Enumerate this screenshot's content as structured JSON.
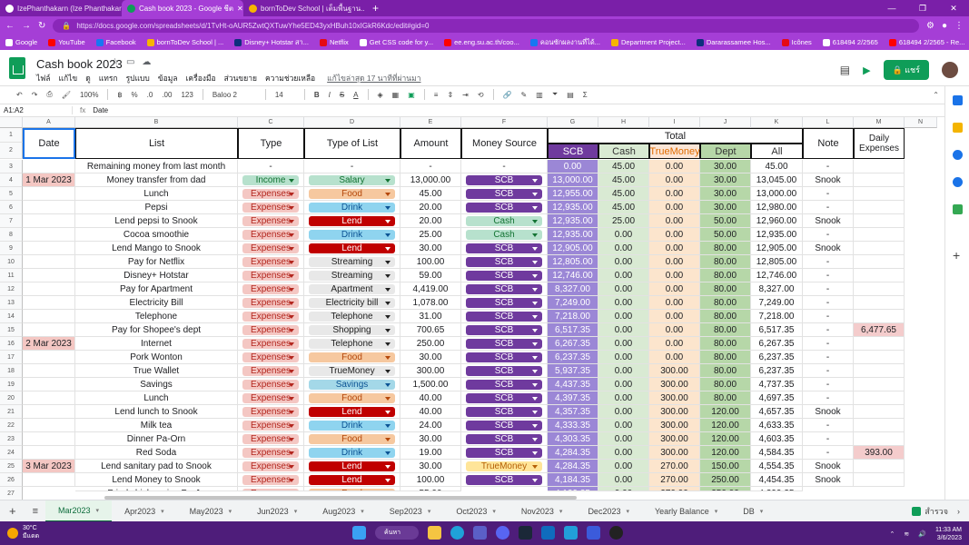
{
  "browser": {
    "tabs": [
      {
        "label": "IzePhanthakarn (Ize Phanthakar...",
        "active": false
      },
      {
        "label": "Cash book 2023 - Google ชีต",
        "active": true
      },
      {
        "label": "bornToDev School | เต็มพื้นฐาน...",
        "active": false
      }
    ],
    "url": "https://docs.google.com/spreadsheets/d/1TvHt-oAUR5ZwtQXTuwYhe5ED43yxHBuh10xIGkR6Kdc/edit#gid=0",
    "bookmarks": [
      "Google",
      "YouTube",
      "Facebook",
      "bornToDev School | ...",
      "Disney+ Hotstar สา...",
      "Netflix",
      "Get CSS code for y...",
      "ee.eng.su.ac.th/coo...",
      "คอนซักผลงานที่ได้...",
      "Department Project...",
      "Dararassamee Hos...",
      "Icônes",
      "618494 2/2565",
      "618494 2/2565 - Re..."
    ]
  },
  "app": {
    "title": "Cash book 2023",
    "menus": [
      "ไฟล์",
      "แก้ไข",
      "ดู",
      "แทรก",
      "รูปแบบ",
      "ข้อมูล",
      "เครื่องมือ",
      "ส่วนขยาย",
      "ความช่วยเหลือ"
    ],
    "last_edit": "แก้ไขล่าสุด 17 นาทีที่ผ่านมา",
    "share_label": "แชร์"
  },
  "toolbar": {
    "zoom": "100%",
    "currency": "฿",
    "percent": "%",
    "dec_less": ".0",
    "dec_more": ".00",
    "format_123": "123",
    "font": "Baloo 2",
    "size": "14",
    "bold": "B",
    "italic": "I",
    "strike": "S",
    "textcolor": "A"
  },
  "formula_bar": {
    "name_box": "A1:A2",
    "fx": "fx",
    "content": "Date"
  },
  "columns": [
    "A",
    "B",
    "C",
    "D",
    "E",
    "F",
    "G",
    "H",
    "I",
    "J",
    "K",
    "L",
    "M",
    "N"
  ],
  "headers": {
    "date": "Date",
    "list": "List",
    "type": "Type",
    "type_of_list": "Type of List",
    "amount": "Amount",
    "money_source": "Money Source",
    "total": "Total",
    "scb": "SCB",
    "cash": "Cash",
    "truemoney": "TrueMoney",
    "dept": "Dept",
    "all": "All",
    "note": "Note",
    "daily_expenses": "Daily Expenses"
  },
  "rows": [
    {
      "n": "3",
      "date": "",
      "list": "Remaining money from last month",
      "type": "-",
      "tol": "-",
      "amount": "-",
      "src": "-",
      "scb": "0.00",
      "cash": "45.00",
      "tm": "0.00",
      "dept": "30.00",
      "all": "45.00",
      "note": "-",
      "daily": ""
    },
    {
      "n": "4",
      "date": "1 Mar 2023",
      "list": "Money transfer from dad",
      "type": "Income",
      "tol": "Salary",
      "amount": "13,000.00",
      "src": "SCB",
      "scb": "13,000.00",
      "cash": "45.00",
      "tm": "0.00",
      "dept": "30.00",
      "all": "13,045.00",
      "note": "Snook",
      "daily": ""
    },
    {
      "n": "5",
      "date": "",
      "list": "Lunch",
      "type": "Expenses",
      "tol": "Food",
      "amount": "45.00",
      "src": "SCB",
      "scb": "12,955.00",
      "cash": "45.00",
      "tm": "0.00",
      "dept": "30.00",
      "all": "13,000.00",
      "note": "-",
      "daily": ""
    },
    {
      "n": "6",
      "date": "",
      "list": "Pepsi",
      "type": "Expenses",
      "tol": "Drink",
      "amount": "20.00",
      "src": "SCB",
      "scb": "12,935.00",
      "cash": "45.00",
      "tm": "0.00",
      "dept": "30.00",
      "all": "12,980.00",
      "note": "-",
      "daily": ""
    },
    {
      "n": "7",
      "date": "",
      "list": "Lend pepsi to Snook",
      "type": "Expenses",
      "tol": "Lend",
      "amount": "20.00",
      "src": "Cash",
      "scb": "12,935.00",
      "cash": "25.00",
      "tm": "0.00",
      "dept": "50.00",
      "all": "12,960.00",
      "note": "Snook",
      "daily": ""
    },
    {
      "n": "8",
      "date": "",
      "list": "Cocoa smoothie",
      "type": "Expenses",
      "tol": "Drink",
      "amount": "25.00",
      "src": "Cash",
      "scb": "12,935.00",
      "cash": "0.00",
      "tm": "0.00",
      "dept": "50.00",
      "all": "12,935.00",
      "note": "-",
      "daily": ""
    },
    {
      "n": "9",
      "date": "",
      "list": "Lend Mango to Snook",
      "type": "Expenses",
      "tol": "Lend",
      "amount": "30.00",
      "src": "SCB",
      "scb": "12,905.00",
      "cash": "0.00",
      "tm": "0.00",
      "dept": "80.00",
      "all": "12,905.00",
      "note": "Snook",
      "daily": ""
    },
    {
      "n": "10",
      "date": "",
      "list": "Pay for Netflix",
      "type": "Expenses",
      "tol": "Streaming",
      "amount": "100.00",
      "src": "SCB",
      "scb": "12,805.00",
      "cash": "0.00",
      "tm": "0.00",
      "dept": "80.00",
      "all": "12,805.00",
      "note": "-",
      "daily": ""
    },
    {
      "n": "11",
      "date": "",
      "list": "Disney+ Hotstar",
      "type": "Expenses",
      "tol": "Streaming",
      "amount": "59.00",
      "src": "SCB",
      "scb": "12,746.00",
      "cash": "0.00",
      "tm": "0.00",
      "dept": "80.00",
      "all": "12,746.00",
      "note": "-",
      "daily": ""
    },
    {
      "n": "12",
      "date": "",
      "list": "Pay for Apartment",
      "type": "Expenses",
      "tol": "Apartment",
      "amount": "4,419.00",
      "src": "SCB",
      "scb": "8,327.00",
      "cash": "0.00",
      "tm": "0.00",
      "dept": "80.00",
      "all": "8,327.00",
      "note": "-",
      "daily": ""
    },
    {
      "n": "13",
      "date": "",
      "list": "Electricity Bill",
      "type": "Expenses",
      "tol": "Electricity bill",
      "amount": "1,078.00",
      "src": "SCB",
      "scb": "7,249.00",
      "cash": "0.00",
      "tm": "0.00",
      "dept": "80.00",
      "all": "7,249.00",
      "note": "-",
      "daily": ""
    },
    {
      "n": "14",
      "date": "",
      "list": "Telephone",
      "type": "Expenses",
      "tol": "Telephone",
      "amount": "31.00",
      "src": "SCB",
      "scb": "7,218.00",
      "cash": "0.00",
      "tm": "0.00",
      "dept": "80.00",
      "all": "7,218.00",
      "note": "-",
      "daily": ""
    },
    {
      "n": "15",
      "date": "",
      "list": "Pay for Shopee's dept",
      "type": "Expenses",
      "tol": "Shopping",
      "amount": "700.65",
      "src": "SCB",
      "scb": "6,517.35",
      "cash": "0.00",
      "tm": "0.00",
      "dept": "80.00",
      "all": "6,517.35",
      "note": "-",
      "daily": "6,477.65"
    },
    {
      "n": "16",
      "date": "2 Mar 2023",
      "list": "Internet",
      "type": "Expenses",
      "tol": "Telephone",
      "amount": "250.00",
      "src": "SCB",
      "scb": "6,267.35",
      "cash": "0.00",
      "tm": "0.00",
      "dept": "80.00",
      "all": "6,267.35",
      "note": "-",
      "daily": ""
    },
    {
      "n": "17",
      "date": "",
      "list": "Pork Wonton",
      "type": "Expenses",
      "tol": "Food",
      "amount": "30.00",
      "src": "SCB",
      "scb": "6,237.35",
      "cash": "0.00",
      "tm": "0.00",
      "dept": "80.00",
      "all": "6,237.35",
      "note": "-",
      "daily": ""
    },
    {
      "n": "18",
      "date": "",
      "list": "True Wallet",
      "type": "Expenses",
      "tol": "TrueMoney",
      "amount": "300.00",
      "src": "SCB",
      "scb": "5,937.35",
      "cash": "0.00",
      "tm": "300.00",
      "dept": "80.00",
      "all": "6,237.35",
      "note": "-",
      "daily": ""
    },
    {
      "n": "19",
      "date": "",
      "list": "Savings",
      "type": "Expenses",
      "tol": "Savings",
      "amount": "1,500.00",
      "src": "SCB",
      "scb": "4,437.35",
      "cash": "0.00",
      "tm": "300.00",
      "dept": "80.00",
      "all": "4,737.35",
      "note": "-",
      "daily": ""
    },
    {
      "n": "20",
      "date": "",
      "list": "Lunch",
      "type": "Expenses",
      "tol": "Food",
      "amount": "40.00",
      "src": "SCB",
      "scb": "4,397.35",
      "cash": "0.00",
      "tm": "300.00",
      "dept": "80.00",
      "all": "4,697.35",
      "note": "-",
      "daily": ""
    },
    {
      "n": "21",
      "date": "",
      "list": "Lend lunch to Snook",
      "type": "Expenses",
      "tol": "Lend",
      "amount": "40.00",
      "src": "SCB",
      "scb": "4,357.35",
      "cash": "0.00",
      "tm": "300.00",
      "dept": "120.00",
      "all": "4,657.35",
      "note": "Snook",
      "daily": ""
    },
    {
      "n": "22",
      "date": "",
      "list": "Milk tea",
      "type": "Expenses",
      "tol": "Drink",
      "amount": "24.00",
      "src": "SCB",
      "scb": "4,333.35",
      "cash": "0.00",
      "tm": "300.00",
      "dept": "120.00",
      "all": "4,633.35",
      "note": "-",
      "daily": ""
    },
    {
      "n": "23",
      "date": "",
      "list": "Dinner Pa-Orn",
      "type": "Expenses",
      "tol": "Food",
      "amount": "30.00",
      "src": "SCB",
      "scb": "4,303.35",
      "cash": "0.00",
      "tm": "300.00",
      "dept": "120.00",
      "all": "4,603.35",
      "note": "-",
      "daily": ""
    },
    {
      "n": "24",
      "date": "",
      "list": "Red Soda",
      "type": "Expenses",
      "tol": "Drink",
      "amount": "19.00",
      "src": "SCB",
      "scb": "4,284.35",
      "cash": "0.00",
      "tm": "300.00",
      "dept": "120.00",
      "all": "4,584.35",
      "note": "-",
      "daily": "393.00"
    },
    {
      "n": "25",
      "date": "3 Mar 2023",
      "list": "Lend sanitary pad to Snook",
      "type": "Expenses",
      "tol": "Lend",
      "amount": "30.00",
      "src": "TrueMoney",
      "scb": "4,284.35",
      "cash": "0.00",
      "tm": "270.00",
      "dept": "150.00",
      "all": "4,554.35",
      "note": "Snook",
      "daily": ""
    },
    {
      "n": "26",
      "date": "",
      "list": "Lend Money to Snook",
      "type": "Expenses",
      "tol": "Lend",
      "amount": "100.00",
      "src": "SCB",
      "scb": "4,184.35",
      "cash": "0.00",
      "tm": "270.00",
      "dept": "250.00",
      "all": "4,454.35",
      "note": "Snook",
      "daily": ""
    }
  ],
  "partial_row": {
    "n": "27",
    "list": "Fried chicken rice Pa-Ja",
    "type": "Expenses",
    "tol": "Food",
    "amount": "55.00",
    "scb": "4,129.35",
    "cash": "0.00",
    "tm": "270.00",
    "dept": "250.00",
    "all": "4,399.35"
  },
  "sheet_tabs": [
    "Mar2023",
    "Apr2023",
    "May2023",
    "Jun2023",
    "Aug2023",
    "Sep2023",
    "Oct2023",
    "Nov2023",
    "Dec2023",
    "Yearly Balance",
    "DB"
  ],
  "explore_label": "สำรวจ",
  "taskbar": {
    "temp": "30°C",
    "weather": "มีแดด",
    "search": "ค้นหา",
    "time": "11:33 AM",
    "date": "3/6/2023"
  },
  "colors": {
    "income": "#b7e1cd",
    "expenses": "#f4c7c3",
    "food": "#f6c89f",
    "drink": "#8fd4ef",
    "lend": "#c00000",
    "streaming": "#e8e8e8",
    "salary": "#b7e1cd",
    "cash_chip": "#b7e1cd",
    "scb_chip": "#6f3a9e",
    "truemoney_chip": "#ffe599",
    "savings": "#a4d8e8",
    "scb_col": "#9b87d6",
    "cash_col": "#d9ead3",
    "tm_col": "#fce5cd",
    "dept_col": "#b6d7a8",
    "all_col": "#ffffff",
    "daily": "#f4cccc",
    "date": "#f4c7c3"
  }
}
